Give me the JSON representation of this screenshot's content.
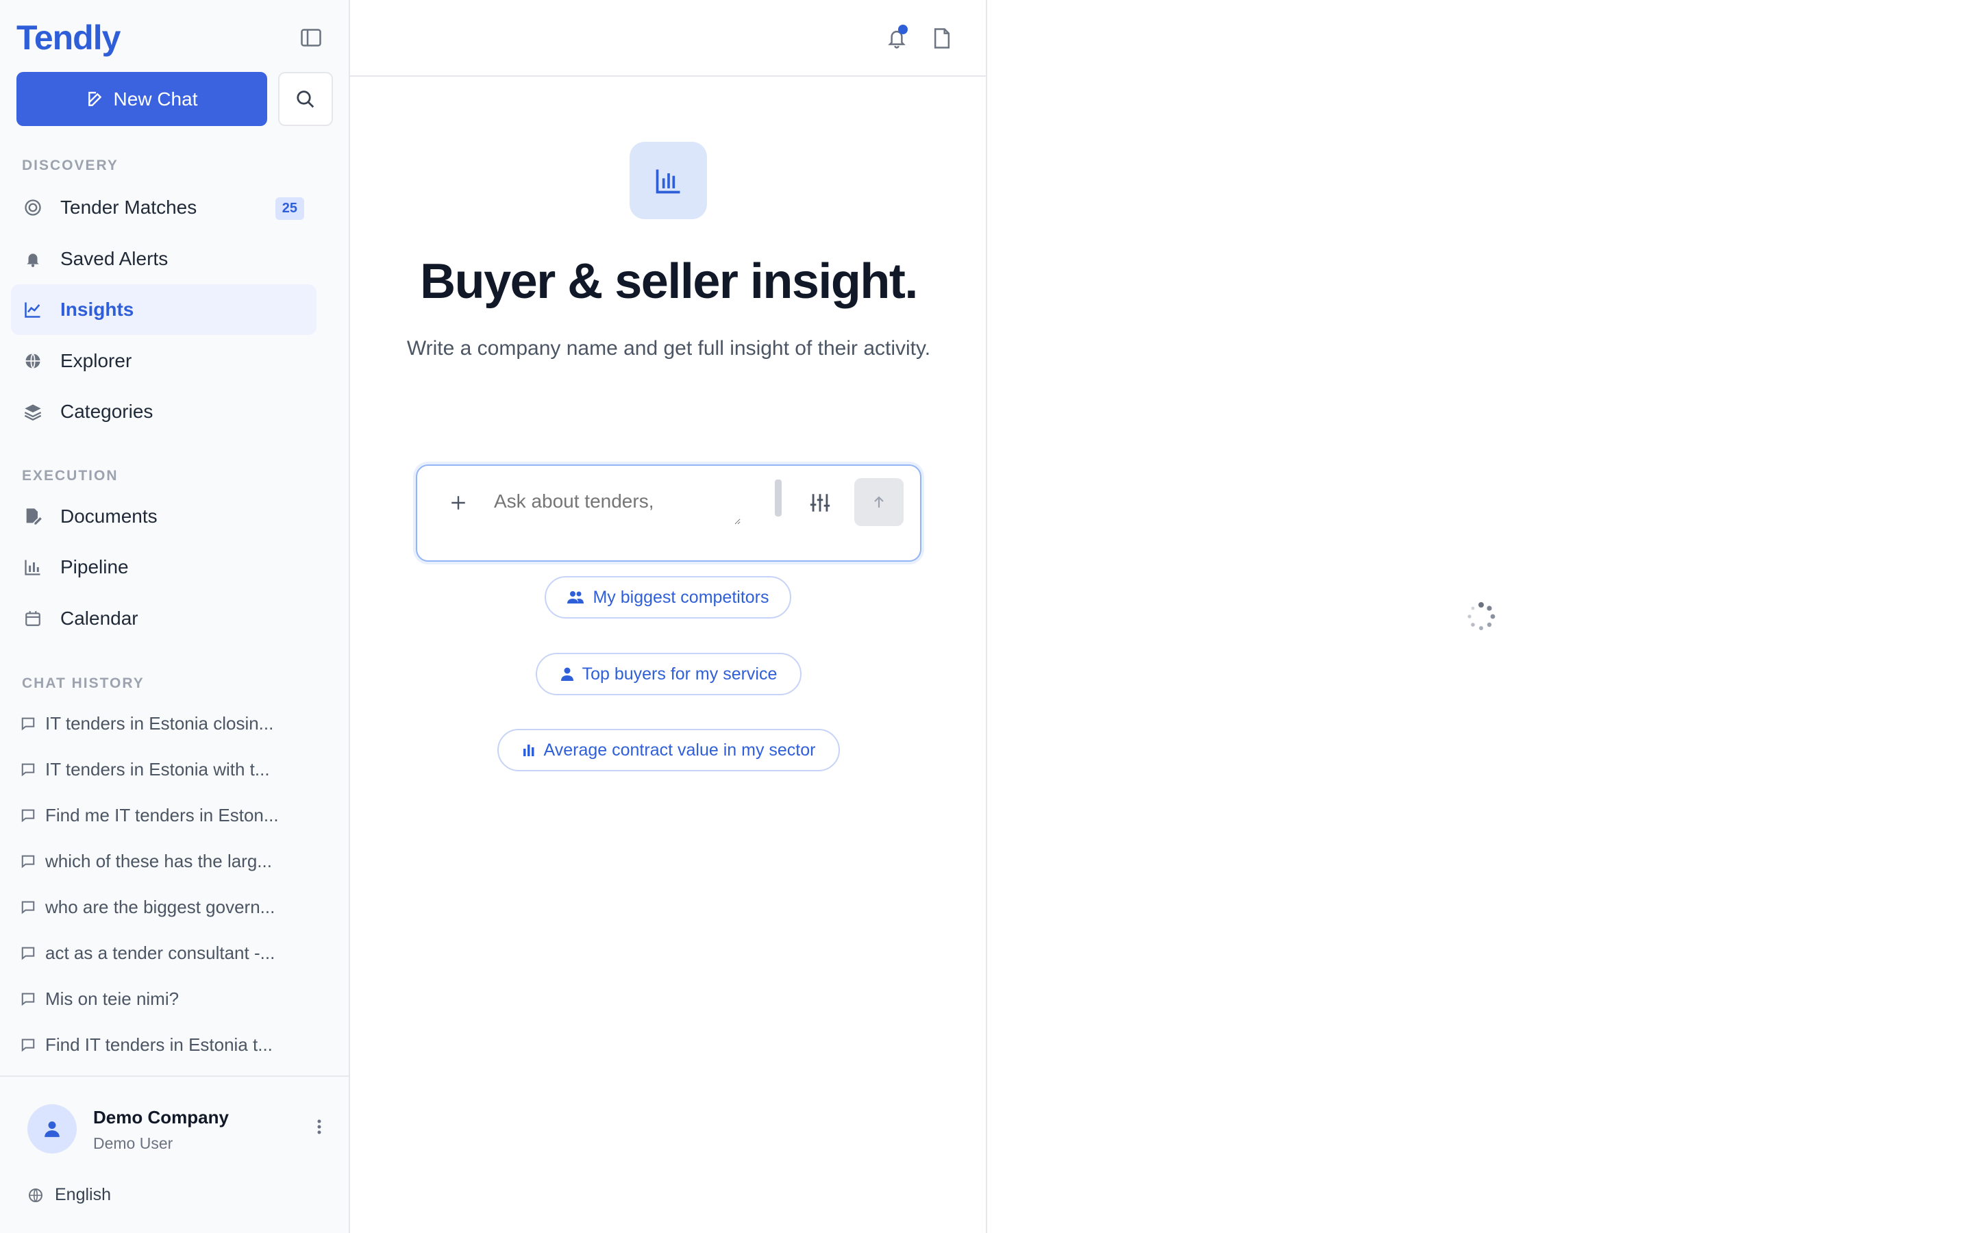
{
  "app": {
    "name": "Tendly"
  },
  "sidebar": {
    "new_chat_label": "New Chat",
    "sections": {
      "discovery": "DISCOVERY",
      "execution": "EXECUTION",
      "chat_history": "CHAT HISTORY"
    },
    "discovery_items": [
      {
        "label": "Tender Matches",
        "icon": "target-icon",
        "badge": "25"
      },
      {
        "label": "Saved Alerts",
        "icon": "bell-icon"
      },
      {
        "label": "Insights",
        "icon": "line-chart-icon",
        "active": true
      },
      {
        "label": "Explorer",
        "icon": "globe-icon"
      },
      {
        "label": "Categories",
        "icon": "layers-icon"
      }
    ],
    "execution_items": [
      {
        "label": "Documents",
        "icon": "file-edit-icon"
      },
      {
        "label": "Pipeline",
        "icon": "bar-chart-icon"
      },
      {
        "label": "Calendar",
        "icon": "calendar-icon"
      }
    ],
    "history": [
      "IT tenders in Estonia closin...",
      "IT tenders in Estonia with t...",
      "Find me IT tenders in Eston...",
      "which of these has the larg...",
      "who are the biggest govern...",
      "act as a tender consultant -...",
      "Mis on teie nimi?",
      "Find IT tenders in Estonia t..."
    ],
    "footer": {
      "company": "Demo Company",
      "user": "Demo User",
      "language": "English"
    }
  },
  "main": {
    "title": "Buyer & seller insight.",
    "subtitle": "Write a company name and get full insight of their activity.",
    "input_placeholder": "Ask about tenders,",
    "suggestions": [
      {
        "label": "My biggest competitors",
        "icon": "users-icon"
      },
      {
        "label": "Top buyers for my service",
        "icon": "user-icon"
      },
      {
        "label": "Average contract value in my sector",
        "icon": "bar-chart-icon"
      }
    ]
  },
  "colors": {
    "accent": "#3b63e0",
    "brand": "#2f5fd8",
    "active_bg": "#eef2ff"
  }
}
